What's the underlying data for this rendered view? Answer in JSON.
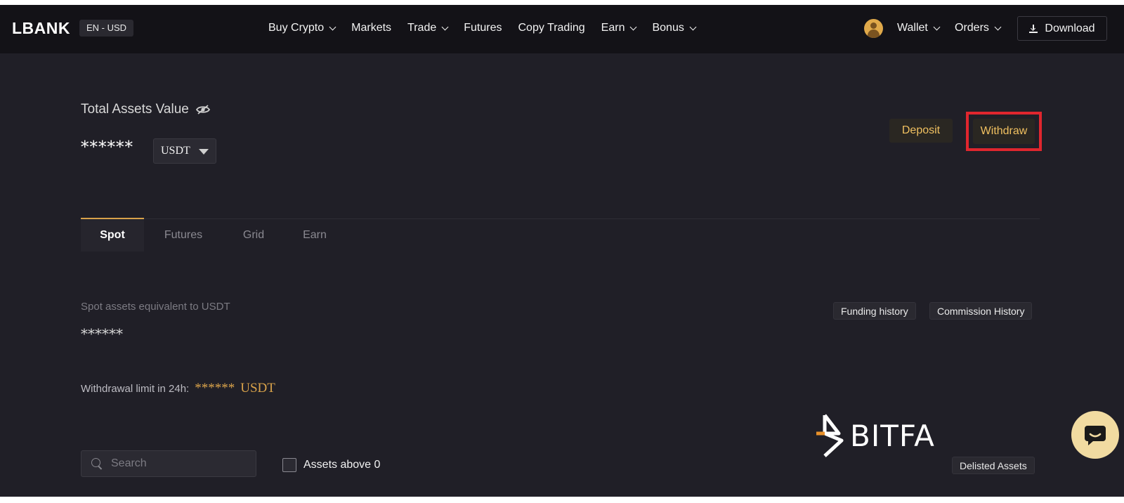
{
  "nav": {
    "logo": "LBANK",
    "lang_currency": "EN - USD",
    "menu": [
      {
        "label": "Buy Crypto",
        "dropdown": true
      },
      {
        "label": "Markets",
        "dropdown": false
      },
      {
        "label": "Trade",
        "dropdown": true
      },
      {
        "label": "Futures",
        "dropdown": false
      },
      {
        "label": "Copy Trading",
        "dropdown": false
      },
      {
        "label": "Earn",
        "dropdown": true
      },
      {
        "label": "Bonus",
        "dropdown": true
      }
    ],
    "wallet_label": "Wallet",
    "orders_label": "Orders",
    "download_label": "Download"
  },
  "assets": {
    "title": "Total Assets Value",
    "value_hidden": "******",
    "currency": "USDT",
    "deposit_label": "Deposit",
    "withdraw_label": "Withdraw"
  },
  "tabs": [
    {
      "label": "Spot",
      "active": true
    },
    {
      "label": "Futures",
      "active": false
    },
    {
      "label": "Grid",
      "active": false
    },
    {
      "label": "Earn",
      "active": false
    }
  ],
  "spot": {
    "equivalent_label": "Spot assets equivalent to USDT",
    "value_hidden": "******",
    "funding_history_label": "Funding history",
    "commission_history_label": "Commission History",
    "withdrawal_limit_label": "Withdrawal limit in 24h:",
    "withdrawal_limit_value": "******",
    "withdrawal_limit_unit": "USDT"
  },
  "filters": {
    "search_placeholder": "Search",
    "assets_above_zero_label": "Assets above 0",
    "delisted_label": "Delisted Assets"
  },
  "watermark": {
    "text": "BITFA"
  },
  "colors": {
    "accent": "#d8a24a",
    "highlight_box": "#e0262e",
    "background": "#201f27",
    "nav_background": "#131217"
  }
}
